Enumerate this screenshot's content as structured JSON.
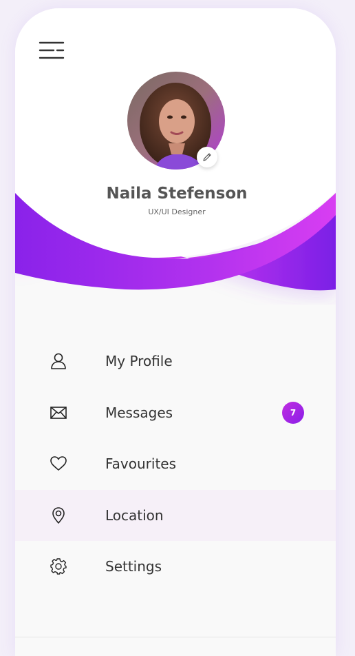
{
  "profile": {
    "name": "Naila Stefenson",
    "role": "UX/UI Designer",
    "avatar_icon": "avatar-photo",
    "edit_icon": "pencil-icon"
  },
  "header": {
    "menu_icon": "hamburger-menu-icon"
  },
  "menu": {
    "items": [
      {
        "label": "My Profile",
        "icon": "user-icon"
      },
      {
        "label": "Messages",
        "icon": "envelope-icon",
        "badge": "7"
      },
      {
        "label": "Favourites",
        "icon": "heart-icon"
      },
      {
        "label": "Location",
        "icon": "location-pin-icon",
        "active": true
      },
      {
        "label": "Settings",
        "icon": "gear-icon"
      }
    ]
  },
  "colors": {
    "accent_purple": "#8a1ee8",
    "accent_magenta": "#d23cf0",
    "active_row": "#f6f0f8",
    "text_dark": "#333333"
  }
}
